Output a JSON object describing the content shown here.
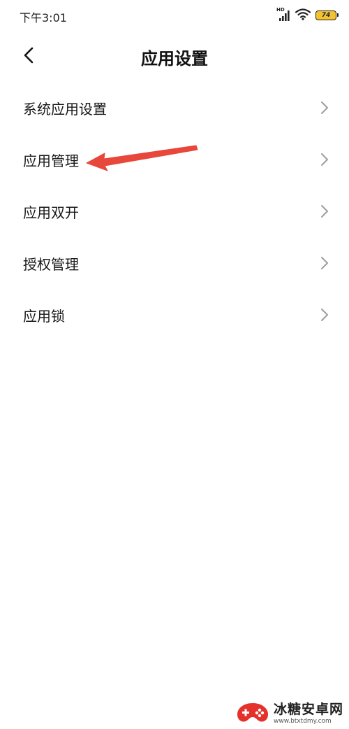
{
  "status_bar": {
    "time": "下午3:01",
    "network_label": "HD",
    "battery_level": "74",
    "battery_color": "#f2c232"
  },
  "header": {
    "title": "应用设置",
    "back_icon": "chevron-left-icon"
  },
  "list": {
    "items": [
      {
        "label": "系统应用设置"
      },
      {
        "label": "应用管理"
      },
      {
        "label": "应用双开"
      },
      {
        "label": "授权管理"
      },
      {
        "label": "应用锁"
      }
    ],
    "chevron_icon": "chevron-right-icon",
    "chevron_color": "#9e9e9e"
  },
  "annotation": {
    "arrow_color": "#e8473b"
  },
  "watermark": {
    "title": "冰糖安卓网",
    "url": "www.btxtdmy.com"
  }
}
